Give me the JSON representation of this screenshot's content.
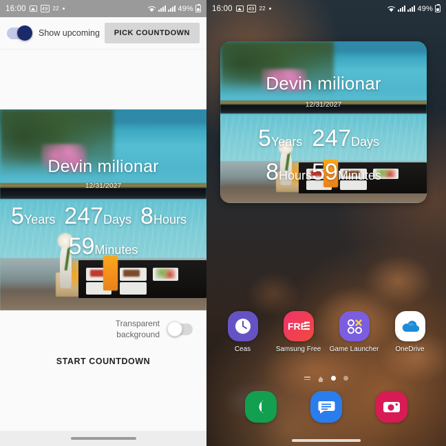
{
  "status_bar": {
    "time": "16:00",
    "badge_count": "49",
    "badge_secondary": "22",
    "battery_percent": "49%",
    "icons": [
      "image-icon",
      "notification-count-badge",
      "notification-badge",
      "dot-icon",
      "wifi-icon",
      "signal-bars-icon",
      "signal-bars-icon",
      "battery-icon"
    ]
  },
  "left_app": {
    "toolbar": {
      "show_upcoming_label": "Show upcoming",
      "show_upcoming_state": "on",
      "pick_countdown_label": "PICK COUNTDOWN"
    },
    "preview": {
      "title": "Devin milionar",
      "date": "12/31/2027",
      "rows": [
        [
          {
            "value": "5",
            "unit": "Years"
          },
          {
            "value": "247",
            "unit": "Days"
          },
          {
            "value": "8",
            "unit": "Hours"
          }
        ],
        [
          {
            "value": "59",
            "unit": "Minutes"
          }
        ]
      ]
    },
    "options": {
      "transparent_background_label": "Transparent background",
      "transparent_background_state": "off"
    },
    "start_button_label": "START COUNTDOWN"
  },
  "right_home": {
    "widget": {
      "title": "Devin milionar",
      "date": "12/31/2027",
      "rows": [
        [
          {
            "value": "5",
            "unit": "Years"
          },
          {
            "value": "247",
            "unit": "Days"
          }
        ],
        [
          {
            "value": "8",
            "unit": "Hours"
          },
          {
            "value": "59",
            "unit": "Minutes"
          }
        ]
      ]
    },
    "apps": [
      {
        "label": "Ceas",
        "icon": "clock-icon"
      },
      {
        "label": "Samsung Free",
        "icon": "samsung-free-icon"
      },
      {
        "label": "Game Launcher",
        "icon": "game-launcher-icon"
      },
      {
        "label": "OneDrive",
        "icon": "onedrive-icon"
      }
    ],
    "page_indicator": {
      "total_dots": 2,
      "active_index": 0
    },
    "dock": [
      {
        "label": "Phone",
        "icon": "phone-icon"
      },
      {
        "label": "Messages",
        "icon": "messages-icon"
      },
      {
        "label": "Camera",
        "icon": "camera-icon"
      }
    ]
  },
  "colors": {
    "status_bar_left": "#9a9a9a",
    "toggle_on_track": "#c5c9e8",
    "toggle_on_thumb": "#1b2a6b",
    "pick_button_bg": "#d6d6d6",
    "app_background": "#fafafa",
    "clock_icon": "#6553c4",
    "samsung_free_icon": "#f0326e",
    "game_launcher_icon": "#7b5de0",
    "onedrive_icon": "#0f6cbd",
    "phone_icon": "#12a050",
    "messages_icon": "#2a7ded",
    "camera_icon": "#d81b55"
  }
}
